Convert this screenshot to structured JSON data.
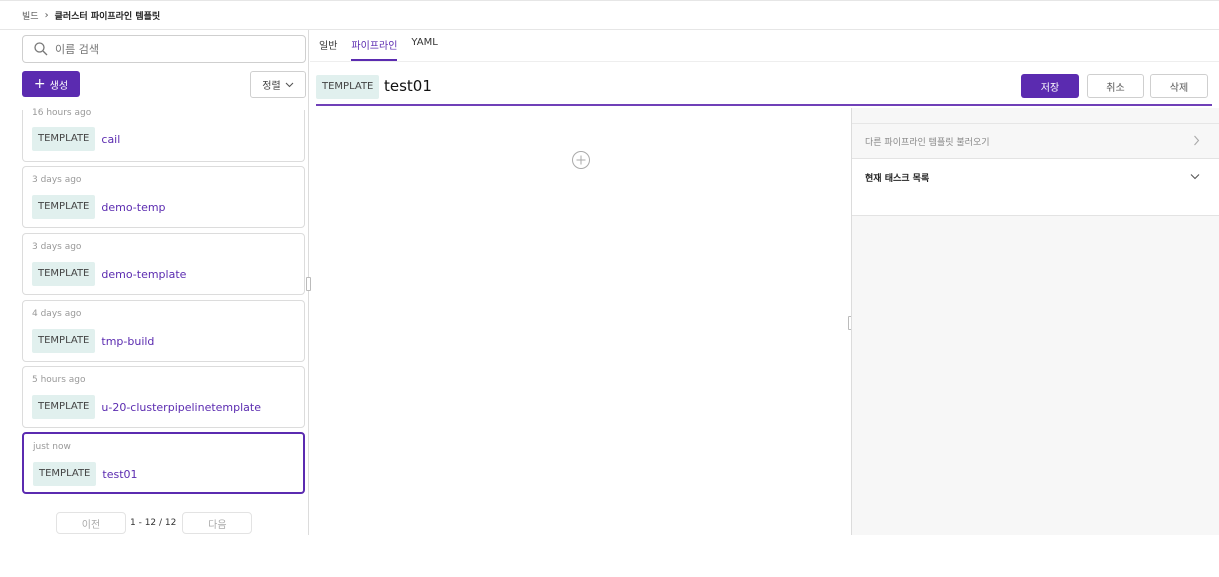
{
  "breadcrumb": {
    "parent": "빌드",
    "separator": "›",
    "current": "클러스터 파이프라인 템플릿"
  },
  "sidebar": {
    "search_placeholder": "이름 검색",
    "create_label": "생성",
    "create_icon": "+",
    "sort_label": "정렬",
    "items": [
      {
        "time": "16 hours ago",
        "tag": "TEMPLATE",
        "name": "cail"
      },
      {
        "time": "3 days ago",
        "tag": "TEMPLATE",
        "name": "demo-temp"
      },
      {
        "time": "3 days ago",
        "tag": "TEMPLATE",
        "name": "demo-template"
      },
      {
        "time": "4 days ago",
        "tag": "TEMPLATE",
        "name": "tmp-build"
      },
      {
        "time": "5 hours ago",
        "tag": "TEMPLATE",
        "name": "u-20-clusterpipelinetemplate"
      },
      {
        "time": "just now",
        "tag": "TEMPLATE",
        "name": "test01"
      }
    ],
    "pager": {
      "prev_label": "이전",
      "info": "1 - 12 / 12",
      "next_label": "다음"
    }
  },
  "tabs": [
    {
      "label": "일반"
    },
    {
      "label": "파이프라인"
    },
    {
      "label": "YAML"
    }
  ],
  "detail": {
    "tag": "TEMPLATE",
    "title": "test01",
    "save_label": "저장",
    "cancel_label": "취소",
    "delete_label": "삭제"
  },
  "right_panel": {
    "load_template_label": "다른 파이프라인 템플릿 불러오기",
    "task_list_label": "현재 태스크 목록"
  },
  "colors": {
    "accent": "#5b2bb0",
    "tag_bg": "#e1f0ee"
  }
}
